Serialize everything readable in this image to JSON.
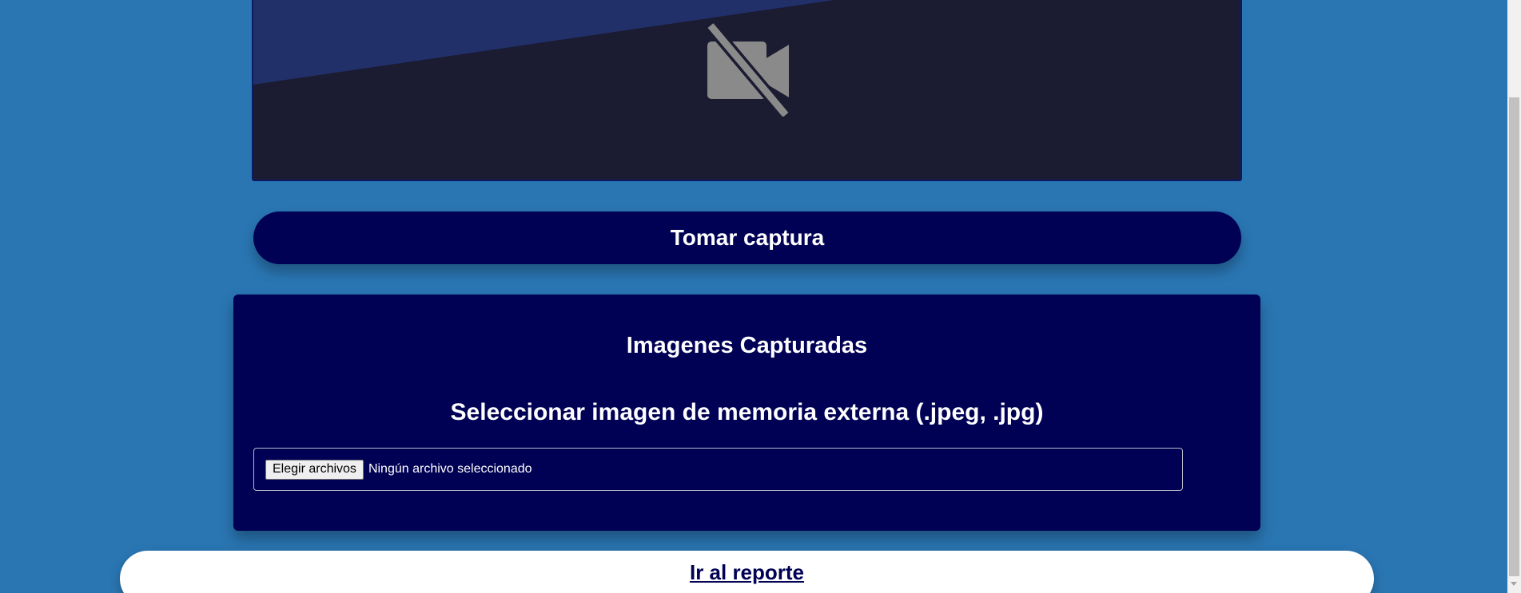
{
  "camera": {
    "status_icon": "video-off-icon",
    "background_colors": {
      "frame": "#1b1b31",
      "stripe": "#22306a"
    }
  },
  "actions": {
    "capture_label": "Tomar captura"
  },
  "captures_panel": {
    "title": "Imagenes Capturadas",
    "subtitle": "Seleccionar imagen de memoria externa (.jpeg, .jpg)",
    "file_input": {
      "button_label": "Elegir archivos",
      "status_text": "Ningún archivo seleccionado"
    }
  },
  "report": {
    "link_label": "Ir al reporte"
  },
  "colors": {
    "page_background": "#2a76b3",
    "primary_dark": "#000055",
    "text_light": "#ffffff"
  }
}
